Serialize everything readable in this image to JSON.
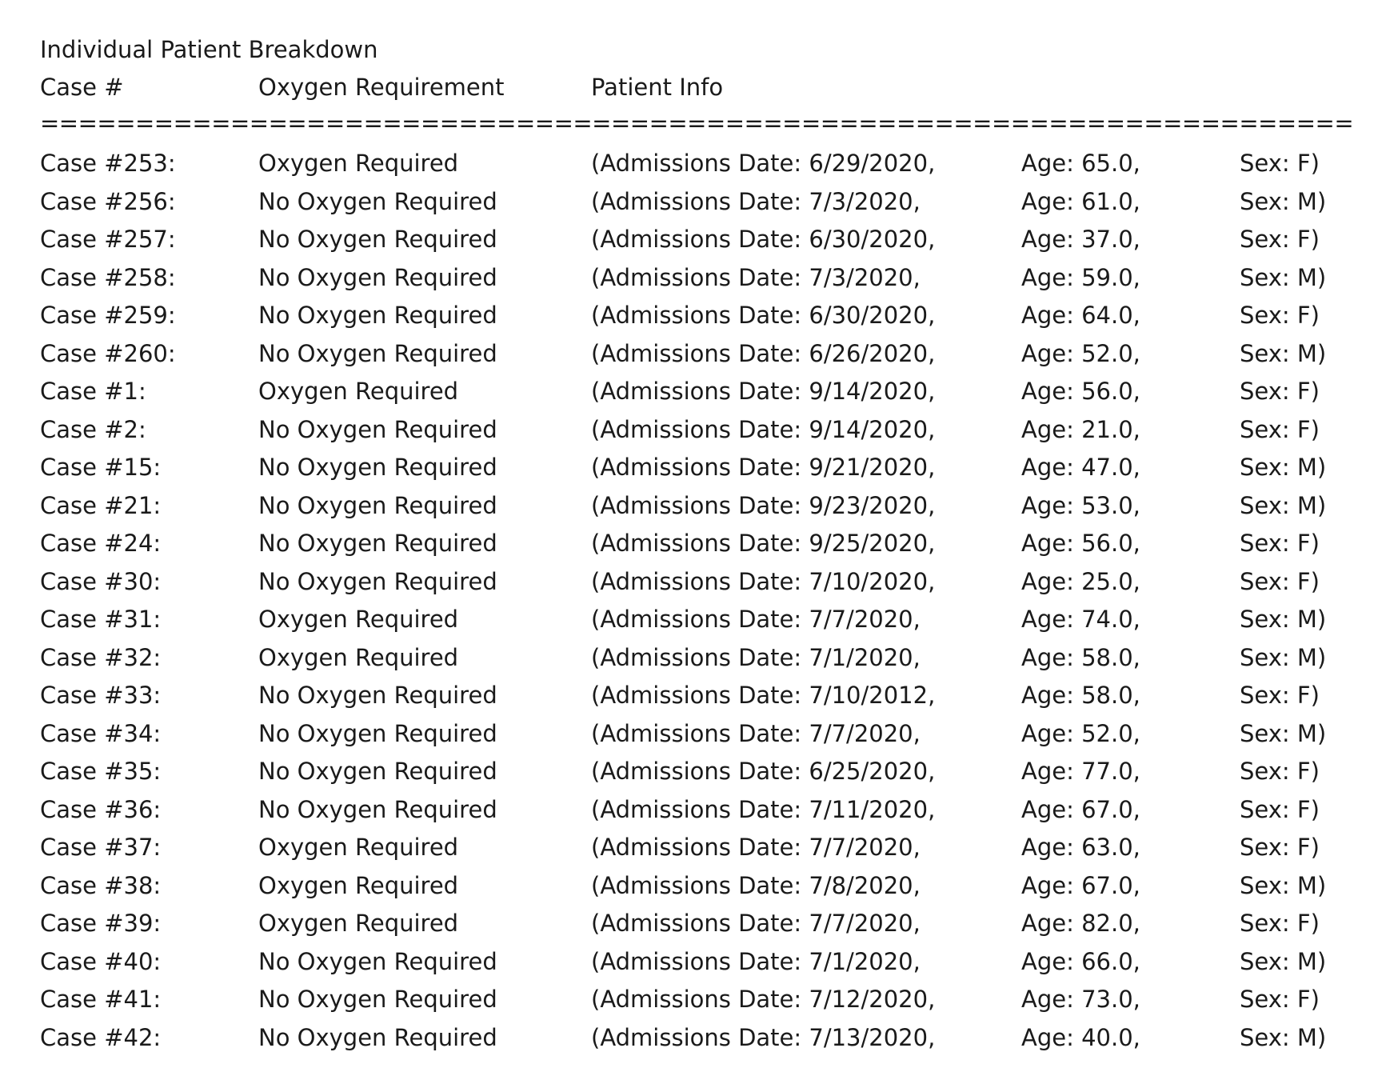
{
  "title": "Individual Patient Breakdown",
  "headers": {
    "case": "Case #",
    "oxygen": "Oxygen Requirement",
    "info": "Patient Info"
  },
  "separator": "==============================================================================================",
  "rows": [
    {
      "case": "Case #253:",
      "oxygen": "Oxygen Required",
      "admission": "(Admissions Date: 6/29/2020,",
      "age": "Age: 65.0,",
      "sex": "Sex: F)"
    },
    {
      "case": "Case #256:",
      "oxygen": "No Oxygen Required",
      "admission": "(Admissions Date: 7/3/2020,",
      "age": "Age: 61.0,",
      "sex": "Sex: M)"
    },
    {
      "case": "Case #257:",
      "oxygen": "No Oxygen Required",
      "admission": "(Admissions Date: 6/30/2020,",
      "age": "Age: 37.0,",
      "sex": "Sex: F)"
    },
    {
      "case": "Case #258:",
      "oxygen": "No Oxygen Required",
      "admission": "(Admissions Date: 7/3/2020,",
      "age": "Age: 59.0,",
      "sex": "Sex: M)"
    },
    {
      "case": "Case #259:",
      "oxygen": "No Oxygen Required",
      "admission": "(Admissions Date: 6/30/2020,",
      "age": "Age: 64.0,",
      "sex": "Sex: F)"
    },
    {
      "case": "Case #260:",
      "oxygen": "No Oxygen Required",
      "admission": "(Admissions Date: 6/26/2020,",
      "age": "Age: 52.0,",
      "sex": "Sex: M)"
    },
    {
      "case": "Case #1:",
      "oxygen": "Oxygen Required",
      "admission": "(Admissions Date: 9/14/2020,",
      "age": "Age: 56.0,",
      "sex": "Sex: F)"
    },
    {
      "case": "Case #2:",
      "oxygen": "No Oxygen Required",
      "admission": "(Admissions Date: 9/14/2020,",
      "age": "Age: 21.0,",
      "sex": "Sex: F)"
    },
    {
      "case": "Case #15:",
      "oxygen": "No Oxygen Required",
      "admission": "(Admissions Date: 9/21/2020,",
      "age": "Age: 47.0,",
      "sex": "Sex: M)"
    },
    {
      "case": "Case #21:",
      "oxygen": "No Oxygen Required",
      "admission": "(Admissions Date: 9/23/2020,",
      "age": "Age: 53.0,",
      "sex": "Sex: M)"
    },
    {
      "case": "Case #24:",
      "oxygen": "No Oxygen Required",
      "admission": "(Admissions Date: 9/25/2020,",
      "age": "Age: 56.0,",
      "sex": "Sex: F)"
    },
    {
      "case": "Case #30:",
      "oxygen": "No Oxygen Required",
      "admission": "(Admissions Date: 7/10/2020,",
      "age": "Age: 25.0,",
      "sex": "Sex: F)"
    },
    {
      "case": "Case #31:",
      "oxygen": "Oxygen Required",
      "admission": "(Admissions Date: 7/7/2020,",
      "age": "Age: 74.0,",
      "sex": "Sex: M)"
    },
    {
      "case": "Case #32:",
      "oxygen": "Oxygen Required",
      "admission": "(Admissions Date: 7/1/2020,",
      "age": "Age: 58.0,",
      "sex": "Sex: M)"
    },
    {
      "case": "Case #33:",
      "oxygen": "No Oxygen Required",
      "admission": "(Admissions Date: 7/10/2012,",
      "age": "Age: 58.0,",
      "sex": "Sex: F)"
    },
    {
      "case": "Case #34:",
      "oxygen": "No Oxygen Required",
      "admission": "(Admissions Date: 7/7/2020,",
      "age": "Age: 52.0,",
      "sex": "Sex: M)"
    },
    {
      "case": "Case #35:",
      "oxygen": "No Oxygen Required",
      "admission": "(Admissions Date: 6/25/2020,",
      "age": "Age: 77.0,",
      "sex": "Sex: F)"
    },
    {
      "case": "Case #36:",
      "oxygen": "No Oxygen Required",
      "admission": "(Admissions Date: 7/11/2020,",
      "age": "Age: 67.0,",
      "sex": "Sex: F)"
    },
    {
      "case": "Case #37:",
      "oxygen": "Oxygen Required",
      "admission": "(Admissions Date: 7/7/2020,",
      "age": "Age: 63.0,",
      "sex": "Sex: F)"
    },
    {
      "case": "Case #38:",
      "oxygen": "Oxygen Required",
      "admission": "(Admissions Date: 7/8/2020,",
      "age": "Age: 67.0,",
      "sex": "Sex: M)"
    },
    {
      "case": "Case #39:",
      "oxygen": "Oxygen Required",
      "admission": "(Admissions Date: 7/7/2020,",
      "age": "Age: 82.0,",
      "sex": "Sex: F)"
    },
    {
      "case": "Case #40:",
      "oxygen": "No Oxygen Required",
      "admission": "(Admissions Date: 7/1/2020,",
      "age": "Age: 66.0,",
      "sex": "Sex: M)"
    },
    {
      "case": "Case #41:",
      "oxygen": "No Oxygen Required",
      "admission": "(Admissions Date: 7/12/2020,",
      "age": "Age: 73.0,",
      "sex": "Sex: F)"
    },
    {
      "case": "Case #42:",
      "oxygen": "No Oxygen Required",
      "admission": "(Admissions Date: 7/13/2020,",
      "age": "Age: 40.0,",
      "sex": "Sex: M)"
    }
  ]
}
